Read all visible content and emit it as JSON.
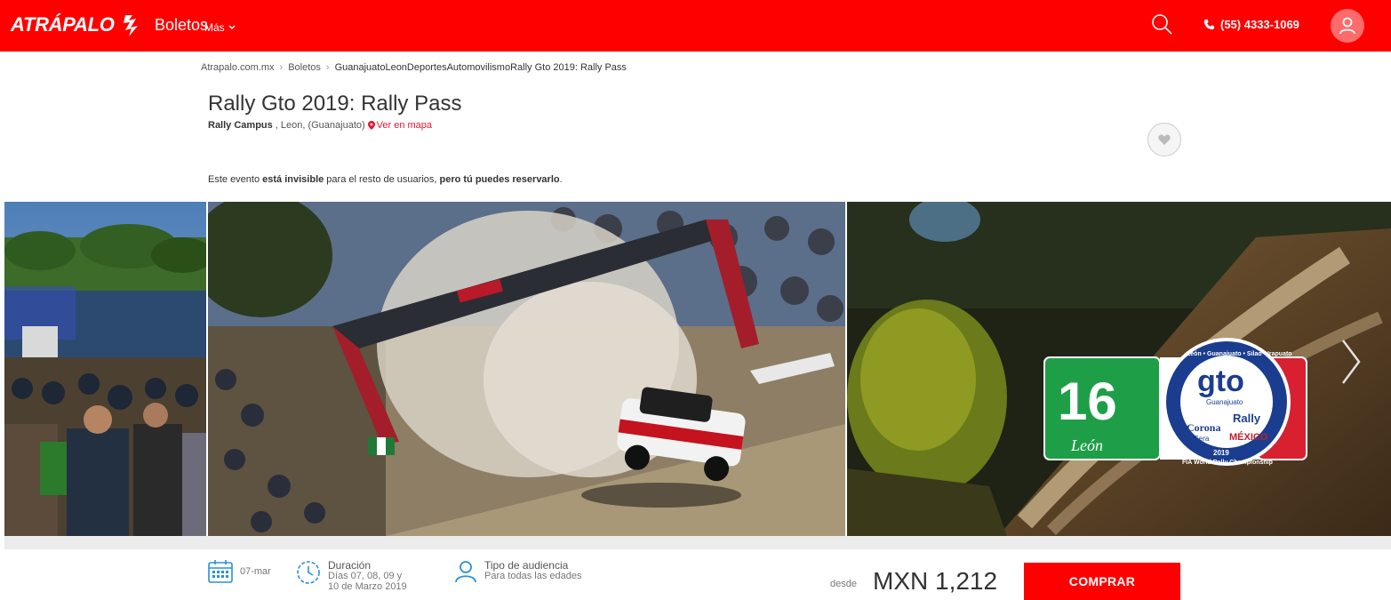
{
  "header": {
    "logo_text": "ATRÁPALO",
    "nav_main": "Boletos",
    "nav_more": "Más",
    "phone": "(55) 4333-1069",
    "brand_color": "#ff0000"
  },
  "breadcrumb": {
    "items": [
      "Atrapalo.com.mx",
      "Boletos",
      "GuanajuatoLeonDeportesAutomovilismoRally Gto 2019: Rally Pass"
    ]
  },
  "event": {
    "title": "Rally Gto 2019: Rally Pass",
    "venue": "Rally Campus",
    "location_rest": ", Leon, (Guanajuato)",
    "map_link": "Ver en mapa"
  },
  "notice": {
    "part1": "Este evento ",
    "bold1": "está invisible",
    "part2": " para el resto de usuarios, ",
    "bold2": "pero tú puedes reservarlo",
    "part3": "."
  },
  "logo_badge": {
    "number": "16",
    "city": "León",
    "ring_text": "León • Guanajuato • Silao • Irapuato",
    "center": "gto",
    "center_sub": "Guanajuato",
    "rally": "Rally",
    "sponsor": "Corona",
    "sponsor_sub": "Cera",
    "country": "MÉXICO",
    "year": "2019",
    "championship": "FIA World Rally Championship"
  },
  "info": {
    "date": "07-mar",
    "duration_label": "Duración",
    "duration_value": "Días 07, 08, 09 y 10 de Marzo 2019",
    "audience_label": "Tipo de audiencia",
    "audience_value": "Para todas las edades",
    "desde": "desde",
    "price": "MXN 1,212",
    "buy_label": "COMPRAR"
  },
  "icons": [
    "search-icon",
    "phone-icon",
    "user-icon",
    "heart-icon",
    "map-pin-icon",
    "calendar-icon",
    "clock-icon",
    "person-icon",
    "chevron-right-icon"
  ]
}
